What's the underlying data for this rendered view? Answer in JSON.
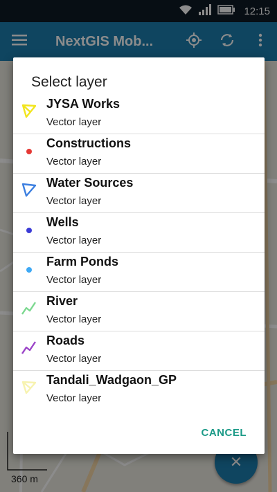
{
  "status_bar": {
    "time": "12:15"
  },
  "toolbar": {
    "title": "NextGIS Mob..."
  },
  "map": {
    "scale_label": "360 m"
  },
  "dialog": {
    "title": "Select layer",
    "layers": [
      {
        "name": "JYSA Works",
        "type": "Vector layer",
        "icon": "polygon-icon",
        "color": "#f2e51d"
      },
      {
        "name": "Constructions",
        "type": "Vector layer",
        "icon": "point-icon",
        "color": "#e53935"
      },
      {
        "name": "Water Sources",
        "type": "Vector layer",
        "icon": "polygon-icon",
        "color": "#3c7fe0"
      },
      {
        "name": "Wells",
        "type": "Vector layer",
        "icon": "point-icon",
        "color": "#3b3bd6"
      },
      {
        "name": "Farm Ponds",
        "type": "Vector layer",
        "icon": "point-icon",
        "color": "#3fa9f5"
      },
      {
        "name": "River",
        "type": "Vector layer",
        "icon": "line-icon",
        "color": "#7bd88f"
      },
      {
        "name": "Roads",
        "type": "Vector layer",
        "icon": "line-icon",
        "color": "#9b44c8"
      },
      {
        "name": "Tandali_Wadgaon_GP",
        "type": "Vector layer",
        "icon": "polygon-icon",
        "color": "#f7f3b0"
      }
    ],
    "cancel_label": "CANCEL"
  },
  "fab": {
    "icon": "close-icon"
  }
}
